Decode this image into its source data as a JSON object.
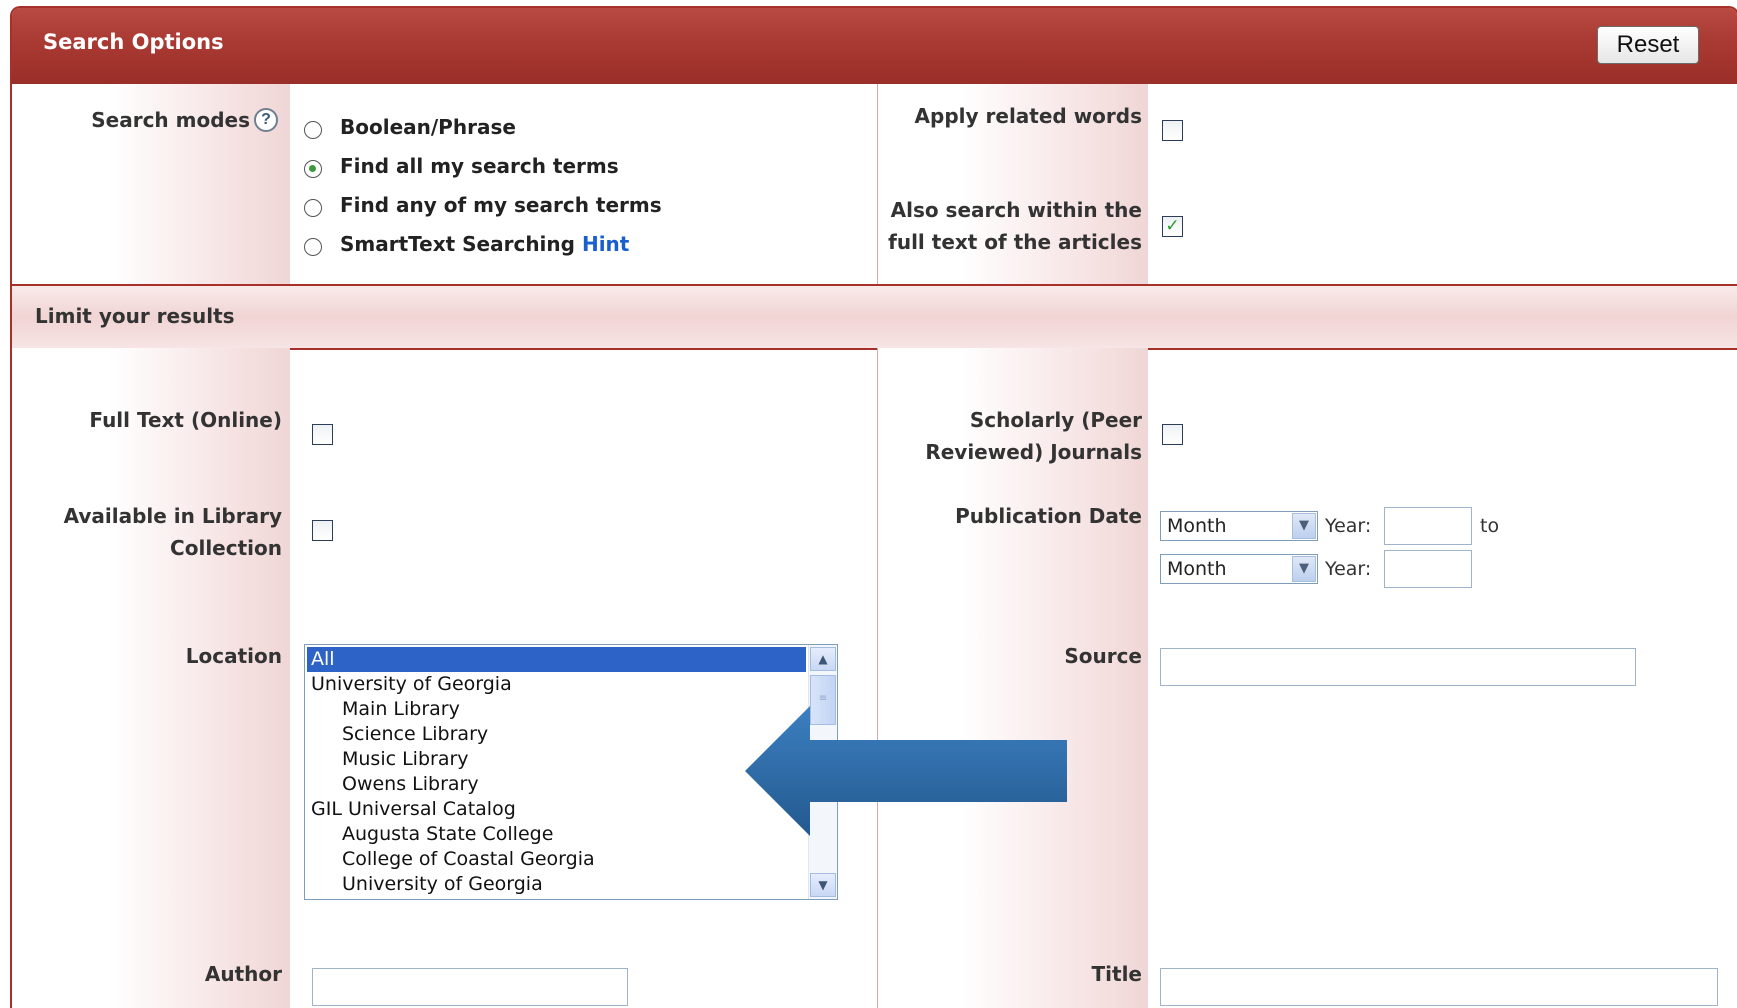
{
  "header": {
    "title": "Search Options",
    "reset_label": "Reset"
  },
  "search_modes": {
    "label": "Search modes",
    "help_icon": "help-question-icon",
    "options": [
      {
        "label": "Boolean/Phrase",
        "checked": false
      },
      {
        "label": "Find all my search terms",
        "checked": true
      },
      {
        "label": "Find any of my search terms",
        "checked": false
      },
      {
        "label": "SmartText Searching",
        "checked": false
      }
    ],
    "hint_link": "Hint"
  },
  "apply_related": {
    "label": "Apply related words",
    "checked": false
  },
  "also_search": {
    "label_line1": "Also search within the",
    "label_line2": "full text of the articles",
    "checked": true
  },
  "limit": {
    "title": "Limit your results",
    "full_text": {
      "label": "Full Text (Online)",
      "checked": false
    },
    "scholarly": {
      "label_line1": "Scholarly (Peer",
      "label_line2": "Reviewed) Journals",
      "checked": false
    },
    "available": {
      "label_line1": "Available in Library",
      "label_line2": "Collection",
      "checked": false
    },
    "pub_date": {
      "label": "Publication Date",
      "month_1": "Month",
      "month_2": "Month",
      "year_label": "Year:",
      "to_label": "to"
    },
    "location": {
      "label": "Location",
      "items": [
        {
          "text": "All",
          "indent": false,
          "selected": true
        },
        {
          "text": "University of Georgia",
          "indent": false,
          "selected": false
        },
        {
          "text": "Main Library",
          "indent": true,
          "selected": false
        },
        {
          "text": "Science Library",
          "indent": true,
          "selected": false
        },
        {
          "text": "Music Library",
          "indent": true,
          "selected": false
        },
        {
          "text": "Owens Library",
          "indent": true,
          "selected": false
        },
        {
          "text": "GIL Universal Catalog",
          "indent": false,
          "selected": false
        },
        {
          "text": "Augusta State College",
          "indent": true,
          "selected": false
        },
        {
          "text": "College of Coastal Georgia",
          "indent": true,
          "selected": false
        },
        {
          "text": "University of Georgia",
          "indent": true,
          "selected": false
        }
      ]
    },
    "source": {
      "label": "Source",
      "value": ""
    },
    "author": {
      "label": "Author",
      "value": ""
    },
    "title_field": {
      "label": "Title",
      "value": ""
    }
  },
  "colors": {
    "header": "#a93a33",
    "accent_link": "#1a5fcf",
    "annotation_arrow": "#2f6fa8"
  }
}
